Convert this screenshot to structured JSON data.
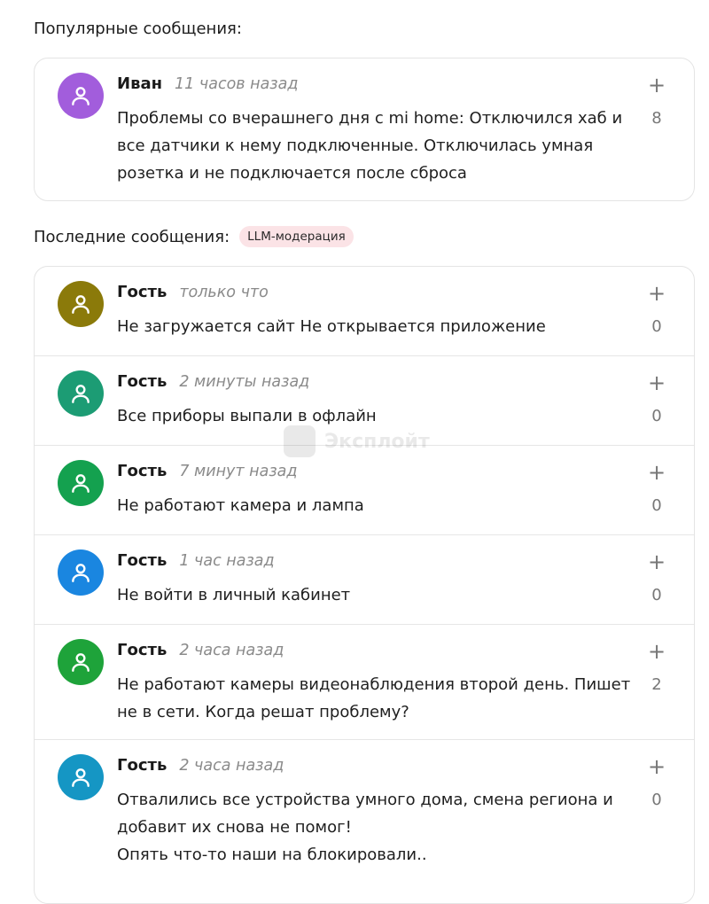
{
  "popular": {
    "title": "Популярные сообщения:",
    "posts": [
      {
        "author": "Иван",
        "time": "11 часов назад",
        "text": "Проблемы со вчерашнего дня с mi home: Отключился хаб и все датчики к нему подключенные. Отключилась умная розетка и не подключается после сброса",
        "plus": "+",
        "count": "8",
        "avatar_color": "#a25ddc"
      }
    ]
  },
  "latest": {
    "title": "Последние сообщения:",
    "badge": "LLM-модерация",
    "posts": [
      {
        "author": "Гость",
        "time": "только что",
        "text": "Не загружается сайт Не открывается приложение",
        "plus": "+",
        "count": "0",
        "avatar_color": "#8b7a0a"
      },
      {
        "author": "Гость",
        "time": "2 минуты назад",
        "text": "Все приборы выпали в офлайн",
        "plus": "+",
        "count": "0",
        "avatar_color": "#1c9c74"
      },
      {
        "author": "Гость",
        "time": "7 минут назад",
        "text": "Не работают камера и лампа",
        "plus": "+",
        "count": "0",
        "avatar_color": "#14a14f"
      },
      {
        "author": "Гость",
        "time": "1 час назад",
        "text": "Не войти в личный кабинет",
        "plus": "+",
        "count": "0",
        "avatar_color": "#1a86e0"
      },
      {
        "author": "Гость",
        "time": "2 часа назад",
        "text": "Не работают камеры видеонаблюдения второй день. Пишет не в сети. Когда решат проблему?",
        "plus": "+",
        "count": "2",
        "avatar_color": "#1ea33a"
      },
      {
        "author": "Гость",
        "time": "2 часа назад",
        "text": "Отвалились все устройства умного дома, смена региона и добавит их снова не помог!\nОпять что-то наши на блокировали..",
        "plus": "+",
        "count": "0",
        "avatar_color": "#1596c4"
      }
    ]
  },
  "watermark": "Эксплойт"
}
